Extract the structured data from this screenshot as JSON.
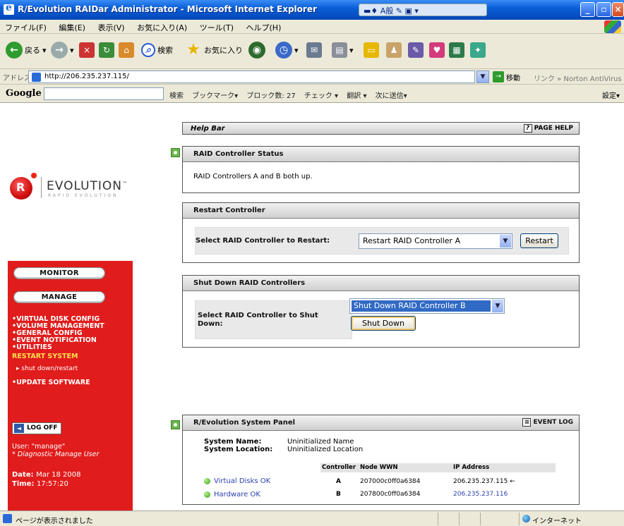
{
  "window": {
    "title": "R/Evolution RAIDar Administrator - Microsoft Internet Explorer",
    "ime": "A般"
  },
  "menu": [
    "ファイル(F)",
    "編集(E)",
    "表示(V)",
    "お気に入り(A)",
    "ツール(T)",
    "ヘルプ(H)"
  ],
  "toolbar": {
    "back_label": "戻る",
    "search_label": "検索",
    "favorites_label": "お気に入り"
  },
  "address": {
    "label": "アドレス(D)",
    "url": "http://206.235.237.115/",
    "go_label": "移動",
    "links_label": "リンク » Norton AntiVirus"
  },
  "google": {
    "logo": "Google",
    "items": [
      "検索",
      "ブックマーク▾",
      "ブロック数: 27",
      "チェック ▾",
      "翻訳 ▾",
      "次に送信▾"
    ],
    "settings_label": "設定▾"
  },
  "brand": {
    "name": "EVOLUTION",
    "tm": "™",
    "sub": "RAPID EVOLUTION"
  },
  "sidebar": {
    "monitor_label": "MONITOR",
    "manage_label": "MANAGE",
    "nav_items": [
      "•VIRTUAL DISK CONFIG",
      "•VOLUME MANAGEMENT",
      "•GENERAL CONFIG",
      "•EVENT NOTIFICATION",
      "•UTILITIES",
      "RESTART SYSTEM",
      "▸ shut down/restart",
      "•UPDATE SOFTWARE"
    ],
    "logoff_label": "LOG OFF",
    "user_line": "User: \"manage\"",
    "user_role": "* Diagnostic Manage User",
    "date_label": "Date:",
    "date_value": "Mar 18 2008",
    "time_label": "Time:",
    "time_value": "17:57:20"
  },
  "helpbar": {
    "title": "Help Bar",
    "page_help": "PAGE HELP"
  },
  "status_panel": {
    "title": "RAID Controller Status",
    "message": "RAID Controllers A and B both up."
  },
  "restart_panel": {
    "title": "Restart Controller",
    "label": "Select RAID Controller to Restart:",
    "selected": "Restart RAID Controller A",
    "button": "Restart"
  },
  "shutdown_panel": {
    "title": "Shut Down RAID Controllers",
    "label_line1": "Select RAID Controller to Shut",
    "label_line2": "Down:",
    "selected": "Shut Down RAID Controller B",
    "button": "Shut Down"
  },
  "system_panel": {
    "title": "R/Evolution System Panel",
    "event_log": "EVENT LOG",
    "name_label": "System Name:",
    "name_value": "Uninitialized Name",
    "location_label": "System Location:",
    "location_value": "Uninitialized Location",
    "headers": [
      "Controller",
      "Node WWN",
      "IP Address"
    ],
    "links": [
      "Virtual Disks OK",
      "Hardware OK"
    ],
    "rows": [
      {
        "controller": "A",
        "wwn": "207000c0ff0a6384",
        "ip": "206.235.237.115 ←"
      },
      {
        "controller": "B",
        "wwn": "207800c0ff0a6384",
        "ip": "206.235.237.116"
      }
    ]
  },
  "statusbar": {
    "message": "ページが表示されました",
    "zone": "インターネット"
  }
}
